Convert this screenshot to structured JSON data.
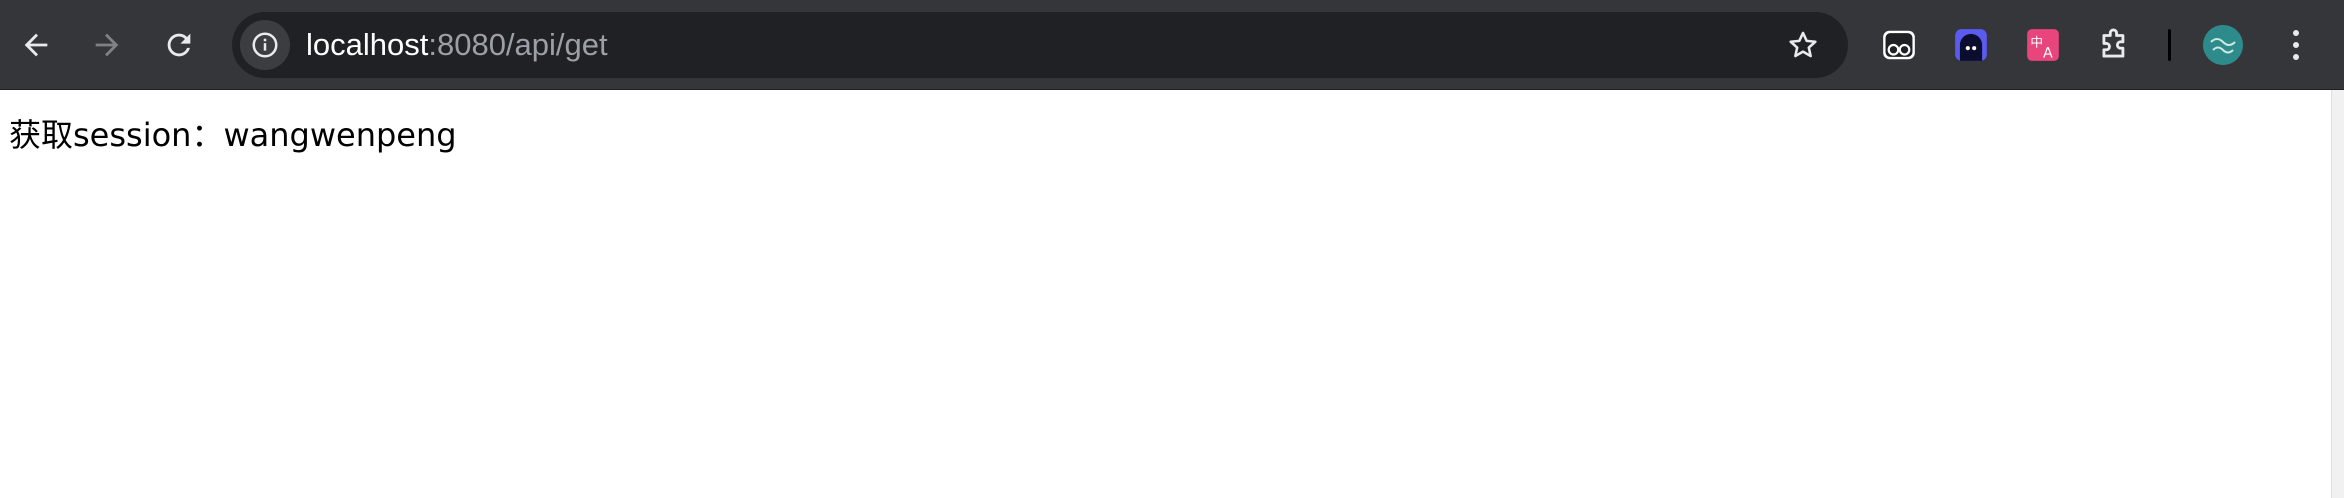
{
  "browser": {
    "url_host": "localhost",
    "url_path": ":8080/api/get",
    "nav": {
      "back_icon": "arrow-left-icon",
      "forward_icon": "arrow-right-icon",
      "reload_icon": "reload-icon"
    },
    "site_info_icon": "info-icon",
    "bookmark_icon": "star-icon",
    "extensions": [
      {
        "name": "eyes-extension-icon",
        "color": "#ffffff"
      },
      {
        "name": "ghost-extension-icon",
        "color": "#5b5bf0"
      },
      {
        "name": "translate-extension-icon",
        "color": "#e8457d"
      },
      {
        "name": "puzzle-extension-icon",
        "color": "#e8eaed"
      }
    ],
    "avatar_color": "#2e8b8b",
    "menu_icon": "kebab-menu-icon"
  },
  "page": {
    "text": "获取session：wangwenpeng"
  }
}
